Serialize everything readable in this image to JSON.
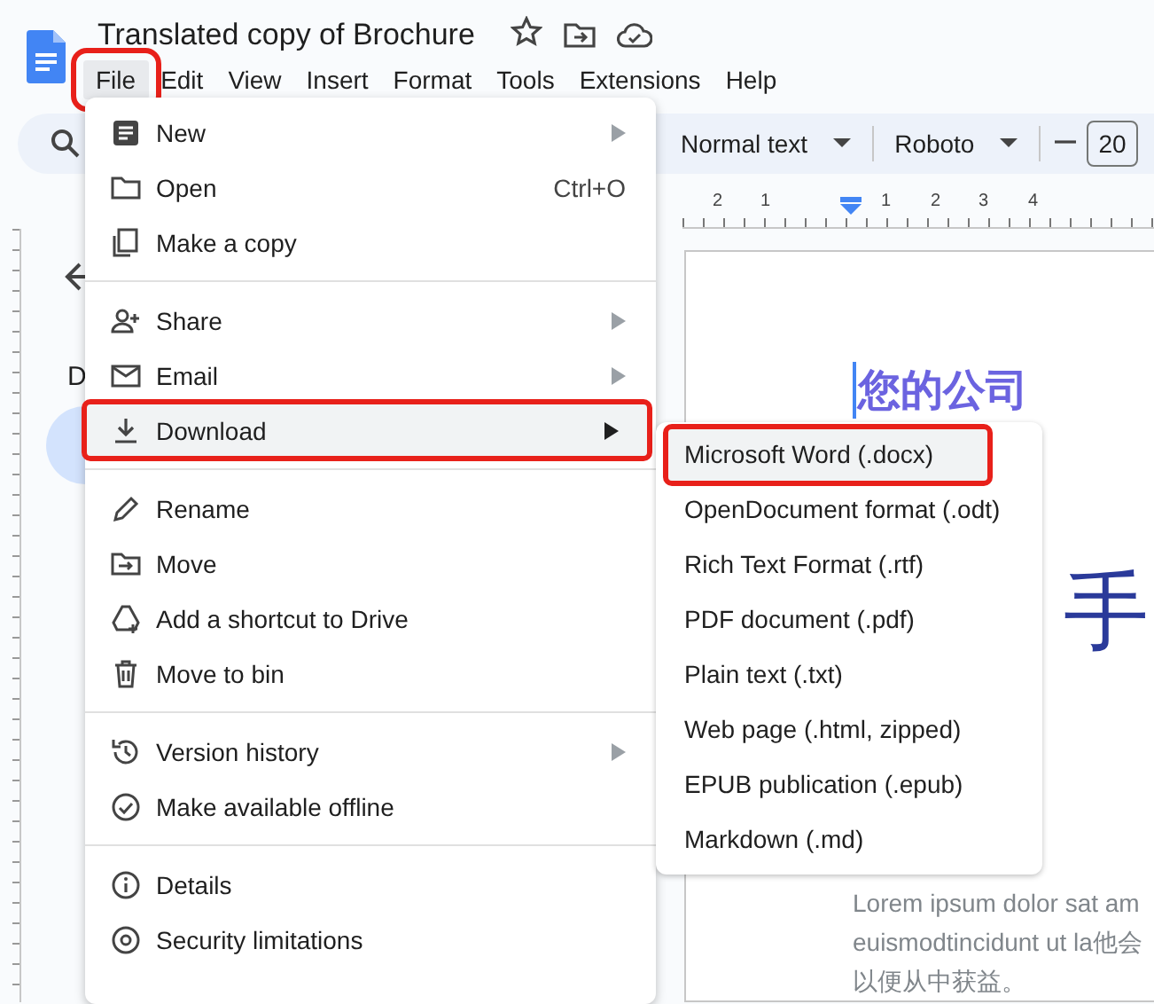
{
  "header": {
    "title": "Translated copy of Brochure",
    "menus": [
      {
        "label": "File",
        "selected": true,
        "annotated": true
      },
      {
        "label": "Edit",
        "selected": false,
        "annotated": false
      },
      {
        "label": "View",
        "selected": false,
        "annotated": false
      },
      {
        "label": "Insert",
        "selected": false,
        "annotated": false
      },
      {
        "label": "Format",
        "selected": false,
        "annotated": false
      },
      {
        "label": "Tools",
        "selected": false,
        "annotated": false
      },
      {
        "label": "Extensions",
        "selected": false,
        "annotated": false
      },
      {
        "label": "Help",
        "selected": false,
        "annotated": false
      }
    ]
  },
  "toolbar": {
    "style": "Normal text",
    "font": "Roboto",
    "font_size": "20"
  },
  "ruler": {
    "numbers": [
      "2",
      "1",
      "1",
      "2",
      "3",
      "4"
    ]
  },
  "outline": {
    "heading": "D"
  },
  "document": {
    "heading": "您的公司",
    "big_glyph": "手",
    "body_lines": [
      "Lorem ipsum dolor sat am",
      "euismodtincidunt ut la他会",
      "以便从中获益。"
    ]
  },
  "file_menu": {
    "groups": [
      [
        {
          "label": "New",
          "submenu": true,
          "selected": false,
          "annotated": false
        },
        {
          "label": "Open",
          "shortcut": "Ctrl+O",
          "submenu": false,
          "selected": false,
          "annotated": false
        },
        {
          "label": "Make a copy",
          "submenu": false,
          "selected": false,
          "annotated": false
        }
      ],
      [
        {
          "label": "Share",
          "submenu": true,
          "selected": false,
          "annotated": false
        },
        {
          "label": "Email",
          "submenu": true,
          "selected": false,
          "annotated": false
        },
        {
          "label": "Download",
          "submenu": true,
          "selected": true,
          "annotated": true
        }
      ],
      [
        {
          "label": "Rename",
          "submenu": false,
          "selected": false,
          "annotated": false
        },
        {
          "label": "Move",
          "submenu": false,
          "selected": false,
          "annotated": false
        },
        {
          "label": "Add a shortcut to Drive",
          "submenu": false,
          "selected": false,
          "annotated": false
        },
        {
          "label": "Move to bin",
          "submenu": false,
          "selected": false,
          "annotated": false
        }
      ],
      [
        {
          "label": "Version history",
          "submenu": true,
          "selected": false,
          "annotated": false
        },
        {
          "label": "Make available offline",
          "submenu": false,
          "selected": false,
          "annotated": false
        }
      ],
      [
        {
          "label": "Details",
          "submenu": false,
          "selected": false,
          "annotated": false
        },
        {
          "label": "Security limitations",
          "submenu": false,
          "selected": false,
          "annotated": false
        }
      ]
    ]
  },
  "download_menu": {
    "items": [
      {
        "label": "Microsoft Word (.docx)",
        "selected": true,
        "annotated": true
      },
      {
        "label": "OpenDocument format (.odt)",
        "selected": false,
        "annotated": false
      },
      {
        "label": "Rich Text Format (.rtf)",
        "selected": false,
        "annotated": false
      },
      {
        "label": "PDF document (.pdf)",
        "selected": false,
        "annotated": false
      },
      {
        "label": "Plain text (.txt)",
        "selected": false,
        "annotated": false
      },
      {
        "label": "Web page (.html, zipped)",
        "selected": false,
        "annotated": false
      },
      {
        "label": "EPUB publication (.epub)",
        "selected": false,
        "annotated": false
      },
      {
        "label": "Markdown (.md)",
        "selected": false,
        "annotated": false
      }
    ]
  }
}
